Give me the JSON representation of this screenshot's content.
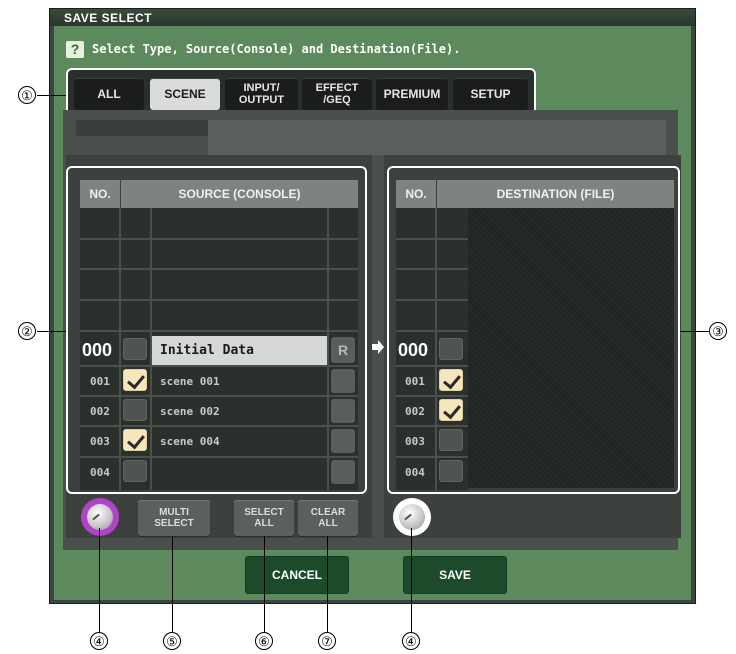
{
  "window": {
    "title": "SAVE SELECT"
  },
  "help": {
    "icon": "?",
    "text": "Select Type, Source(Console) and Destination(File)."
  },
  "tabs": [
    {
      "label": "ALL",
      "active": false
    },
    {
      "label": "SCENE",
      "active": true
    },
    {
      "label": "INPUT/\nOUTPUT",
      "active": false
    },
    {
      "label": "EFFECT\n/GEQ",
      "active": false
    },
    {
      "label": "PREMIUM",
      "active": false
    },
    {
      "label": "SETUP",
      "active": false
    }
  ],
  "source": {
    "header_no": "NO.",
    "header_title": "SOURCE (CONSOLE)",
    "rows": [
      {
        "no": "000",
        "checked": false,
        "name": "Initial Data",
        "button": "R"
      },
      {
        "no": "001",
        "checked": true,
        "name": "scene 001"
      },
      {
        "no": "002",
        "checked": false,
        "name": "scene 002"
      },
      {
        "no": "003",
        "checked": true,
        "name": "scene 004"
      },
      {
        "no": "004",
        "checked": false,
        "name": ""
      }
    ]
  },
  "destination": {
    "header_no": "NO.",
    "header_title": "DESTINATION (FILE)",
    "rows": [
      {
        "no": "000",
        "checked": false
      },
      {
        "no": "001",
        "checked": true
      },
      {
        "no": "002",
        "checked": true
      },
      {
        "no": "003",
        "checked": false
      },
      {
        "no": "004",
        "checked": false
      }
    ]
  },
  "controls": {
    "multi_select": "MULTI\nSELECT",
    "select_all": "SELECT\nALL",
    "clear_all": "CLEAR\nALL",
    "cancel": "CANCEL",
    "save": "SAVE"
  },
  "callouts": [
    "①",
    "②",
    "③",
    "④",
    "⑤",
    "⑥",
    "⑦",
    "④"
  ]
}
